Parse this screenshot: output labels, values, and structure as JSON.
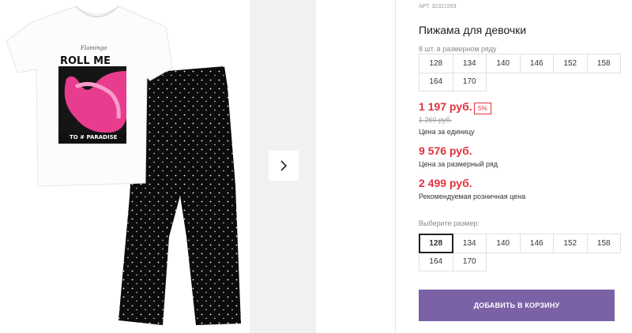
{
  "product": {
    "sku": "АРТ. 32321553",
    "title": "Пижама для девочки",
    "tshirt_print": {
      "script": "Flamingo",
      "headline": "ROLL ME",
      "banner": "TO # PARADISE"
    }
  },
  "pack": {
    "label": "8 шт. в размерном ряду",
    "sizes": [
      "128",
      "134",
      "140",
      "146",
      "152",
      "158",
      "164",
      "170"
    ]
  },
  "prices": {
    "unit_price": "1 197 руб.",
    "discount": "5%",
    "old_price": "1 260 руб.",
    "unit_label": "Цена за единицу",
    "pack_price": "9 576 руб.",
    "pack_label": "Цена за размерный ряд",
    "retail_price": "2 499 руб.",
    "retail_label": "Рекомендуемая розничная цена"
  },
  "size_select": {
    "label": "Выберите размер:",
    "sizes": [
      "128",
      "134",
      "140",
      "146",
      "152",
      "158",
      "164",
      "170"
    ],
    "selected": "128"
  },
  "actions": {
    "add_to_cart": "ДОБАВИТЬ В КОРЗИНУ"
  },
  "colors": {
    "price_red": "#e2313d",
    "button_purple": "#7b62a7",
    "gallery_bg": "#f1f1f1"
  },
  "icons": {
    "next": "chevron-right-icon"
  }
}
